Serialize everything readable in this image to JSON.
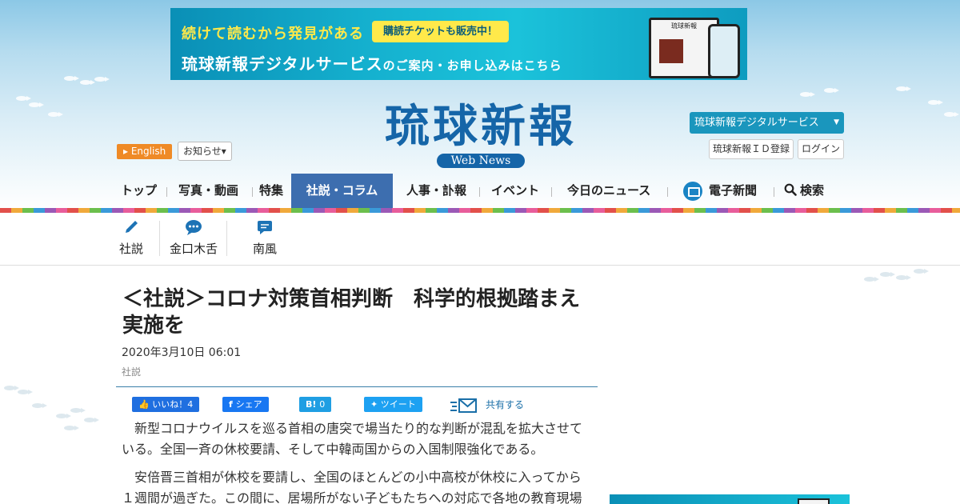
{
  "banner": {
    "line1": "続けて読むから発見がある",
    "pill": "購読チケットも販売中！",
    "line2_main": "琉球新報デジタルサービス",
    "line2_small": "のご案内・お申し込みはこちら",
    "device_title": "琉球新報"
  },
  "header": {
    "logo": "琉球新報",
    "logo_sub": "Web News",
    "english_label": "English",
    "notice_label": "お知らせ▾",
    "digital_label": "琉球新報デジタルサービス",
    "id_register_label": "琉球新報ＩＤ登録",
    "login_label": "ログイン"
  },
  "nav": {
    "items": [
      {
        "label": "トップ"
      },
      {
        "label": "写真・動画"
      },
      {
        "label": "特集"
      },
      {
        "label": "社説・コラム"
      },
      {
        "label": "人事・訃報"
      },
      {
        "label": "イベント"
      },
      {
        "label": "今日のニュース"
      },
      {
        "label": "電子新聞"
      },
      {
        "label": "検索"
      }
    ],
    "active_index": 3
  },
  "subnav": {
    "items": [
      {
        "label": "社説",
        "icon": "pen-icon"
      },
      {
        "label": "金口木舌",
        "icon": "speech-bubble-icon"
      },
      {
        "label": "南風",
        "icon": "chat-icon"
      }
    ]
  },
  "article": {
    "title": "＜社説＞コロナ対策首相判断　科学的根拠踏まえ実施を",
    "date": "2020年3月10日 06:01",
    "category": "社説",
    "share": {
      "like": "いいね！4",
      "facebook": "シェア",
      "hatena_count": "0",
      "tweet": "ツイート",
      "mail": "共有する"
    },
    "paragraphs": [
      "新型コロナウイルスを巡る首相の唐突で場当たり的な判断が混乱を拡大させている。全国一斉の休校要請、そして中韓両国からの入国制限強化である。",
      "安倍晋三首相が休校を要請し、全国のほとんどの小中高校が休校に入ってから１週間が過ぎた。この間に、居場所がない子どもたちへの対応で各地の教育現場"
    ]
  },
  "colors": {
    "brand_blue": "#1565a8",
    "nav_active": "#3d6eaf",
    "digital_button": "#1a96bd",
    "english_button": "#ef8a26"
  }
}
